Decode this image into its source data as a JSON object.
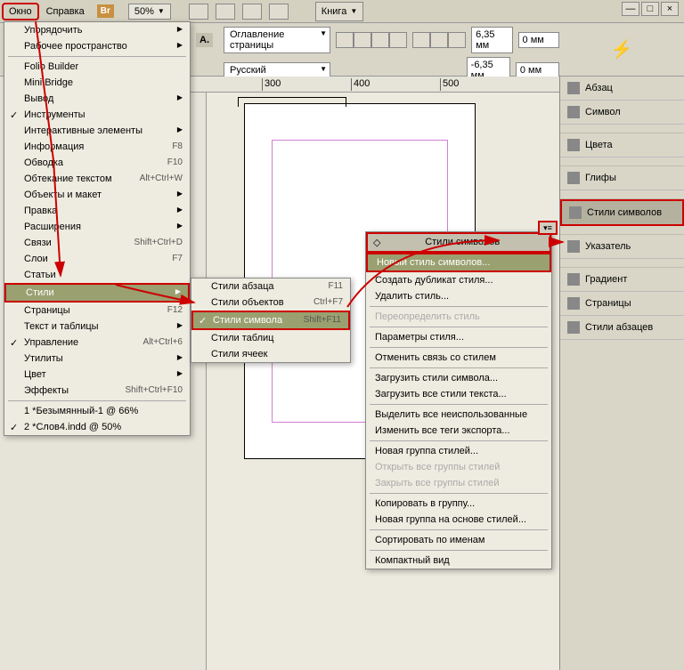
{
  "menubar": {
    "window": "Окно",
    "help": "Справка",
    "br": "Br",
    "zoom": "50%",
    "book": "Книга"
  },
  "toolbar2": {
    "toc": "Оглавление страницы",
    "lang": "Русский",
    "val1": "6,35 мм",
    "val2": "-6,35 мм",
    "val3": "0 мм",
    "val4": "0 мм"
  },
  "dropdown": [
    {
      "label": "Упорядочить",
      "type": "arrow"
    },
    {
      "label": "Рабочее пространство",
      "type": "arrow"
    },
    {
      "type": "sep"
    },
    {
      "label": "Folio Builder"
    },
    {
      "label": "Mini Bridge"
    },
    {
      "label": "Вывод",
      "type": "arrow"
    },
    {
      "label": "Инструменты",
      "type": "check"
    },
    {
      "label": "Интерактивные элементы",
      "type": "arrow"
    },
    {
      "label": "Информация",
      "shortcut": "F8"
    },
    {
      "label": "Обводка",
      "shortcut": "F10"
    },
    {
      "label": "Обтекание текстом",
      "shortcut": "Alt+Ctrl+W"
    },
    {
      "label": "Объекты и макет",
      "type": "arrow"
    },
    {
      "label": "Правка",
      "type": "arrow"
    },
    {
      "label": "Расширения",
      "type": "arrow"
    },
    {
      "label": "Связи",
      "shortcut": "Shift+Ctrl+D"
    },
    {
      "label": "Слои",
      "shortcut": "F7"
    },
    {
      "label": "Статьи"
    },
    {
      "label": "Стили",
      "type": "hl-arrow"
    },
    {
      "label": "Страницы",
      "shortcut": "F12"
    },
    {
      "label": "Текст и таблицы",
      "type": "arrow"
    },
    {
      "label": "Управление",
      "shortcut": "Alt+Ctrl+6",
      "type": "check"
    },
    {
      "label": "Утилиты",
      "type": "arrow"
    },
    {
      "label": "Цвет",
      "type": "arrow"
    },
    {
      "label": "Эффекты",
      "shortcut": "Shift+Ctrl+F10"
    },
    {
      "type": "sep"
    },
    {
      "label": "1 *Безымянный-1 @ 66%"
    },
    {
      "label": "2 *Слов4.indd @ 50%",
      "type": "check"
    }
  ],
  "submenu": [
    {
      "label": "Стили абзаца",
      "shortcut": "F11"
    },
    {
      "label": "Стили объектов",
      "shortcut": "Ctrl+F7"
    },
    {
      "label": "Стили символа",
      "shortcut": "Shift+F11",
      "hl": true,
      "check": true
    },
    {
      "label": "Стили таблиц"
    },
    {
      "label": "Стили ячеек"
    }
  ],
  "panelmenu": {
    "header": "Стили символов",
    "items": [
      {
        "label": "Новый стиль символов...",
        "hl": true
      },
      {
        "label": "Создать дубликат стиля..."
      },
      {
        "label": "Удалить стиль..."
      },
      {
        "type": "sep"
      },
      {
        "label": "Переопределить стиль",
        "dis": true
      },
      {
        "type": "sep"
      },
      {
        "label": "Параметры стиля..."
      },
      {
        "type": "sep"
      },
      {
        "label": "Отменить связь со стилем"
      },
      {
        "type": "sep"
      },
      {
        "label": "Загрузить стили символа..."
      },
      {
        "label": "Загрузить все стили текста..."
      },
      {
        "type": "sep"
      },
      {
        "label": "Выделить все неиспользованные"
      },
      {
        "label": "Изменить все теги экспорта..."
      },
      {
        "type": "sep"
      },
      {
        "label": "Новая группа стилей..."
      },
      {
        "label": "Открыть все группы стилей",
        "dis": true
      },
      {
        "label": "Закрыть все группы стилей",
        "dis": true
      },
      {
        "type": "sep"
      },
      {
        "label": "Копировать в группу..."
      },
      {
        "label": "Новая группа на основе стилей..."
      },
      {
        "type": "sep"
      },
      {
        "label": "Сортировать по именам"
      },
      {
        "type": "sep"
      },
      {
        "label": "Компактный вид"
      }
    ]
  },
  "panels": [
    {
      "label": "Абзац"
    },
    {
      "label": "Символ"
    },
    {
      "type": "sep"
    },
    {
      "label": "Цвета"
    },
    {
      "type": "sep"
    },
    {
      "label": "Глифы"
    },
    {
      "type": "sep"
    },
    {
      "label": "Стили символов",
      "sel": true
    },
    {
      "type": "sep"
    },
    {
      "label": "Указатель"
    },
    {
      "type": "sep"
    },
    {
      "label": "Градиент"
    },
    {
      "label": "Страницы"
    },
    {
      "label": "Стили абзацев"
    }
  ],
  "ruler": {
    "marks": [
      300,
      400,
      500
    ]
  }
}
